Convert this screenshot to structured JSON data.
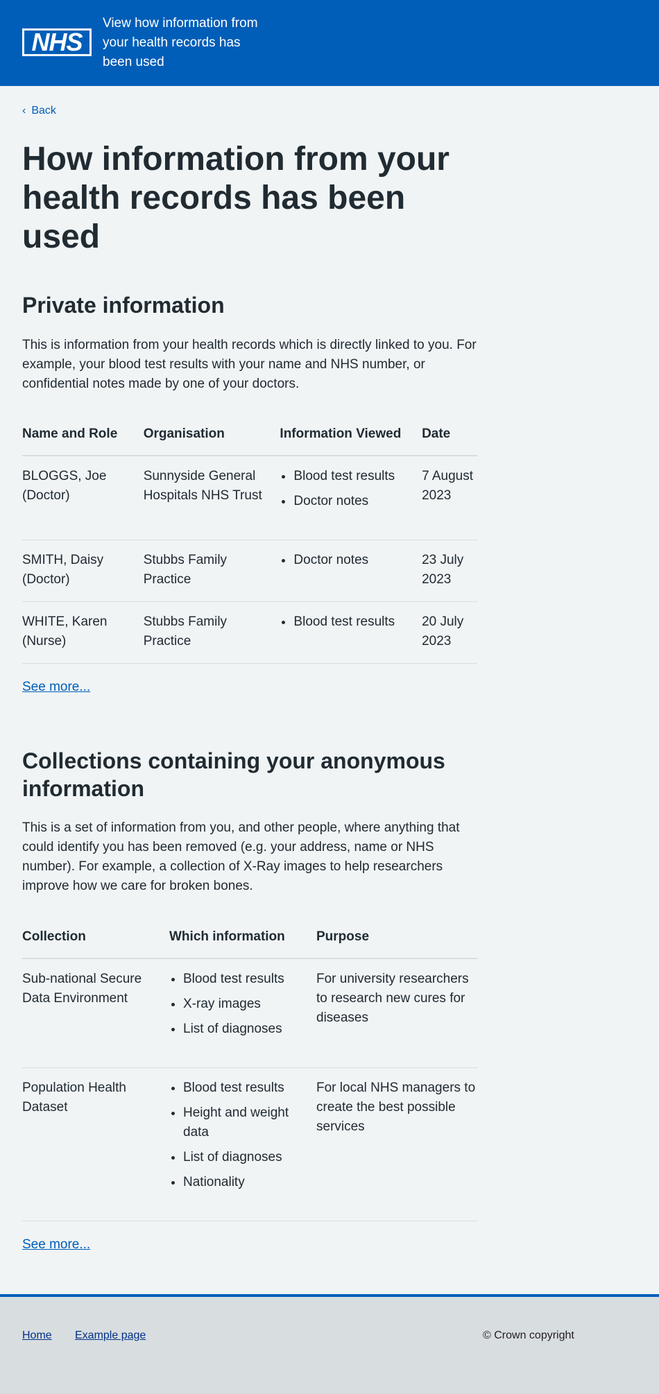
{
  "header": {
    "logo_text": "NHS",
    "service_name": "View how information from your health records has been used"
  },
  "back_link": "Back",
  "page_title": "How information from your health records has been used",
  "private": {
    "heading": "Private information",
    "description": "This is information from your health records which is directly linked to you. For example, your blood test results with your name and NHS number, or confidential notes made by one of your doctors.",
    "columns": [
      "Name and Role",
      "Organisation",
      "Information Viewed",
      "Date"
    ],
    "rows": [
      {
        "name": "BLOGGS, Joe (Doctor)",
        "organisation": "Sunnyside General Hospitals NHS Trust",
        "info": [
          "Blood test results",
          "Doctor notes"
        ],
        "date": "7 August 2023"
      },
      {
        "name": "SMITH, Daisy (Doctor)",
        "organisation": "Stubbs Family Practice",
        "info": [
          "Doctor notes"
        ],
        "date": "23 July 2023"
      },
      {
        "name": "WHITE, Karen (Nurse)",
        "organisation": "Stubbs Family Practice",
        "info": [
          "Blood test results"
        ],
        "date": "20 July 2023"
      }
    ],
    "see_more": "See more..."
  },
  "collections": {
    "heading": "Collections containing your anonymous information",
    "description": "This is a set of information from you, and other people, where anything that could identify you has been removed (e.g. your address, name or NHS number). For example, a collection of X-Ray images to help researchers improve how we care for broken bones.",
    "columns": [
      "Collection",
      "Which information",
      "Purpose"
    ],
    "rows": [
      {
        "collection": "Sub-national Secure Data Environment",
        "info": [
          "Blood test results",
          "X-ray images",
          "List of diagnoses"
        ],
        "purpose": "For university researchers to research new cures for diseases"
      },
      {
        "collection": "Population Health Dataset",
        "info": [
          "Blood test results",
          "Height and weight data",
          "List of diagnoses",
          "Nationality"
        ],
        "purpose": "For local NHS managers to create the best possible services"
      }
    ],
    "see_more": "See more..."
  },
  "footer": {
    "links": [
      "Home",
      "Example page"
    ],
    "copyright": "© Crown copyright"
  },
  "colors": {
    "nhs_blue": "#005eb8",
    "background": "#f0f4f5",
    "text": "#212b32",
    "footer_bg": "#d8dde0"
  }
}
